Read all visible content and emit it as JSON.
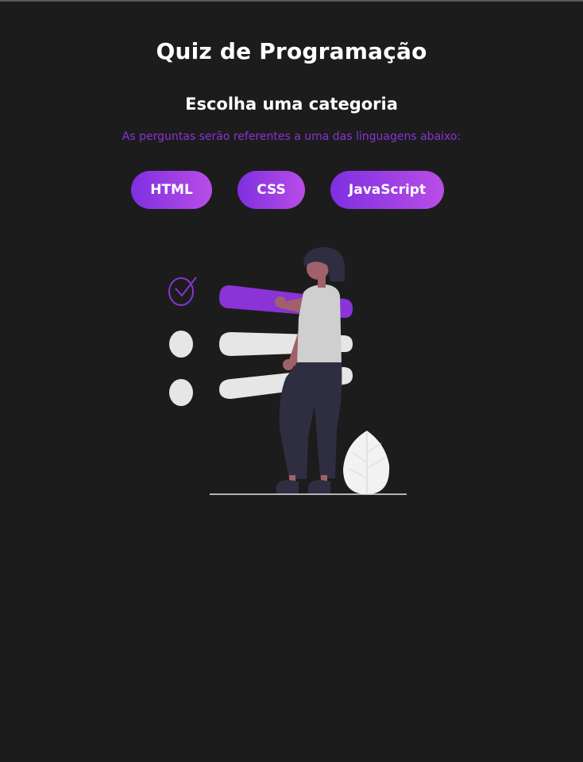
{
  "page": {
    "title": "Quiz de Programação",
    "subtitle": "Escolha uma categoria",
    "description": "As perguntas serão referentes a uma das linguagens abaixo:"
  },
  "categories": {
    "html": "HTML",
    "css": "CSS",
    "javascript": "JavaScript"
  },
  "illustration": {
    "name": "woman-checklist-illustration"
  },
  "colors": {
    "background": "#1c1c1c",
    "accent": "#8a33d6",
    "button_gradient_start": "#7e2fe0",
    "button_gradient_end": "#b94de8",
    "text": "#ffffff"
  }
}
